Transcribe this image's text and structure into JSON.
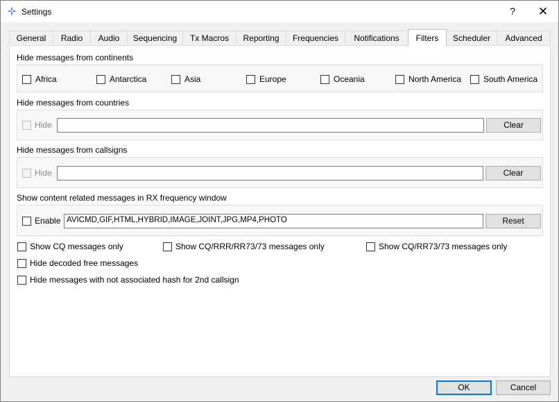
{
  "window": {
    "title": "Settings",
    "help_glyph": "?",
    "close_glyph": "✕"
  },
  "tabs": [
    {
      "label": "General",
      "active": false
    },
    {
      "label": "Radio",
      "active": false
    },
    {
      "label": "Audio",
      "active": false
    },
    {
      "label": "Sequencing",
      "active": false
    },
    {
      "label": "Tx Macros",
      "active": false
    },
    {
      "label": "Reporting",
      "active": false
    },
    {
      "label": "Frequencies",
      "active": false
    },
    {
      "label": "Notifications",
      "active": false
    },
    {
      "label": "Filters",
      "active": true
    },
    {
      "label": "Scheduler",
      "active": false
    },
    {
      "label": "Advanced",
      "active": false
    }
  ],
  "continents": {
    "heading": "Hide messages from continents",
    "items": [
      {
        "label": "Africa",
        "checked": false
      },
      {
        "label": "Antarctica",
        "checked": false
      },
      {
        "label": "Asia",
        "checked": false
      },
      {
        "label": "Europe",
        "checked": false
      },
      {
        "label": "Oceania",
        "checked": false
      },
      {
        "label": "North America",
        "checked": false
      },
      {
        "label": "South America",
        "checked": false
      }
    ]
  },
  "countries": {
    "heading": "Hide messages from countries",
    "hide_label": "Hide",
    "value": "",
    "button": "Clear"
  },
  "callsigns": {
    "heading": "Hide messages from callsigns",
    "hide_label": "Hide",
    "value": "",
    "button": "Clear"
  },
  "content": {
    "heading": "Show content related messages in RX frequency window",
    "enable_label": "Enable",
    "value": "AVICMD,GIF,HTML,HYBRID,IMAGE,JOINT,JPG,MP4,PHOTO",
    "button": "Reset"
  },
  "options": {
    "cq_only": "Show CQ messages only",
    "cq_rrr": "Show CQ/RRR/RR73/73 messages only",
    "cq_rr73": "Show CQ/RR73/73 messages only",
    "hide_free": "Hide decoded free messages",
    "hide_hash": "Hide messages with not associated hash for 2nd callsign"
  },
  "footer": {
    "ok": "OK",
    "cancel": "Cancel"
  },
  "colors": {
    "accent": "#0078d7",
    "icon": "#3a5bd9"
  }
}
